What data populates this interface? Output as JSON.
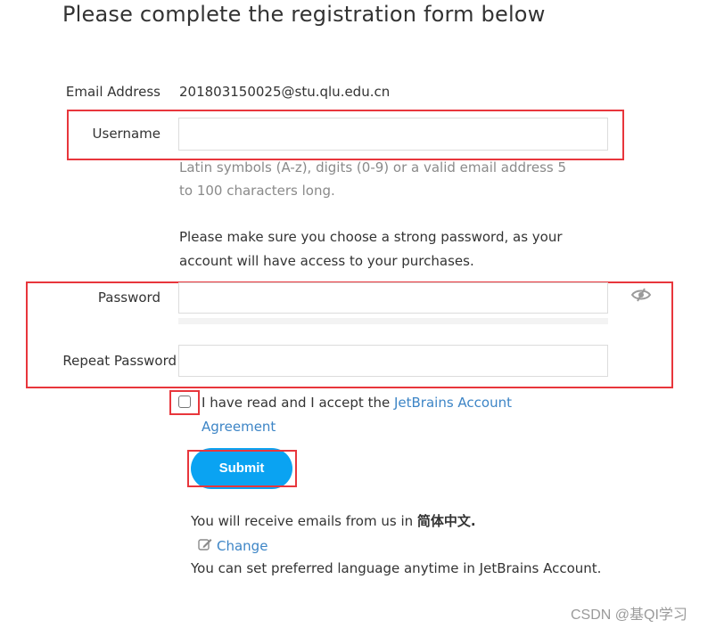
{
  "page": {
    "title": "Please complete the registration form below"
  },
  "form": {
    "email_label": "Email Address",
    "email_value": "201803150025@stu.qlu.edu.cn",
    "username_label": "Username",
    "username_value": "",
    "username_hint": "Latin symbols (A-z), digits (0-9) or a valid email address 5 to 100 characters long.",
    "password_notice": "Please make sure you choose a strong password, as your account will have access to your purchases.",
    "password_label": "Password",
    "password_value": "",
    "password_visibility_icon": "eye-slash-icon",
    "repeat_password_label": "Repeat Password",
    "repeat_password_value": "",
    "agreement_checked": false,
    "agreement_text": "I have read and I accept the ",
    "agreement_link": "JetBrains Account Agreement",
    "submit_label": "Submit"
  },
  "language": {
    "receive_text": "You will receive emails from us in ",
    "language_name": "简体中文.",
    "change_icon": "edit-icon",
    "change_label": "Change",
    "set_text": "You can set preferred language anytime in JetBrains Account."
  },
  "watermark": "CSDN @基QI学习",
  "colors": {
    "highlight_border": "#e8363c",
    "submit_bg": "#0aa3f2",
    "link": "#3d85c6"
  }
}
